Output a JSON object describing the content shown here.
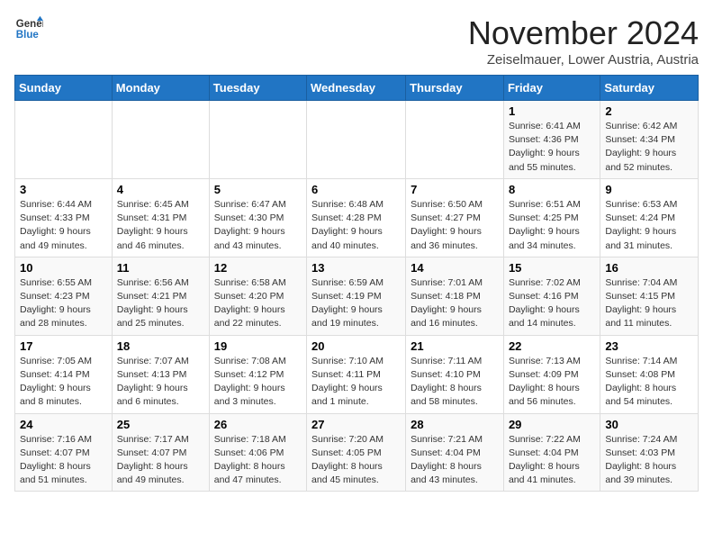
{
  "logo": {
    "line1": "General",
    "line2": "Blue"
  },
  "title": "November 2024",
  "location": "Zeiselmauer, Lower Austria, Austria",
  "days_header": [
    "Sunday",
    "Monday",
    "Tuesday",
    "Wednesday",
    "Thursday",
    "Friday",
    "Saturday"
  ],
  "weeks": [
    [
      {
        "day": "",
        "info": ""
      },
      {
        "day": "",
        "info": ""
      },
      {
        "day": "",
        "info": ""
      },
      {
        "day": "",
        "info": ""
      },
      {
        "day": "",
        "info": ""
      },
      {
        "day": "1",
        "info": "Sunrise: 6:41 AM\nSunset: 4:36 PM\nDaylight: 9 hours\nand 55 minutes."
      },
      {
        "day": "2",
        "info": "Sunrise: 6:42 AM\nSunset: 4:34 PM\nDaylight: 9 hours\nand 52 minutes."
      }
    ],
    [
      {
        "day": "3",
        "info": "Sunrise: 6:44 AM\nSunset: 4:33 PM\nDaylight: 9 hours\nand 49 minutes."
      },
      {
        "day": "4",
        "info": "Sunrise: 6:45 AM\nSunset: 4:31 PM\nDaylight: 9 hours\nand 46 minutes."
      },
      {
        "day": "5",
        "info": "Sunrise: 6:47 AM\nSunset: 4:30 PM\nDaylight: 9 hours\nand 43 minutes."
      },
      {
        "day": "6",
        "info": "Sunrise: 6:48 AM\nSunset: 4:28 PM\nDaylight: 9 hours\nand 40 minutes."
      },
      {
        "day": "7",
        "info": "Sunrise: 6:50 AM\nSunset: 4:27 PM\nDaylight: 9 hours\nand 36 minutes."
      },
      {
        "day": "8",
        "info": "Sunrise: 6:51 AM\nSunset: 4:25 PM\nDaylight: 9 hours\nand 34 minutes."
      },
      {
        "day": "9",
        "info": "Sunrise: 6:53 AM\nSunset: 4:24 PM\nDaylight: 9 hours\nand 31 minutes."
      }
    ],
    [
      {
        "day": "10",
        "info": "Sunrise: 6:55 AM\nSunset: 4:23 PM\nDaylight: 9 hours\nand 28 minutes."
      },
      {
        "day": "11",
        "info": "Sunrise: 6:56 AM\nSunset: 4:21 PM\nDaylight: 9 hours\nand 25 minutes."
      },
      {
        "day": "12",
        "info": "Sunrise: 6:58 AM\nSunset: 4:20 PM\nDaylight: 9 hours\nand 22 minutes."
      },
      {
        "day": "13",
        "info": "Sunrise: 6:59 AM\nSunset: 4:19 PM\nDaylight: 9 hours\nand 19 minutes."
      },
      {
        "day": "14",
        "info": "Sunrise: 7:01 AM\nSunset: 4:18 PM\nDaylight: 9 hours\nand 16 minutes."
      },
      {
        "day": "15",
        "info": "Sunrise: 7:02 AM\nSunset: 4:16 PM\nDaylight: 9 hours\nand 14 minutes."
      },
      {
        "day": "16",
        "info": "Sunrise: 7:04 AM\nSunset: 4:15 PM\nDaylight: 9 hours\nand 11 minutes."
      }
    ],
    [
      {
        "day": "17",
        "info": "Sunrise: 7:05 AM\nSunset: 4:14 PM\nDaylight: 9 hours\nand 8 minutes."
      },
      {
        "day": "18",
        "info": "Sunrise: 7:07 AM\nSunset: 4:13 PM\nDaylight: 9 hours\nand 6 minutes."
      },
      {
        "day": "19",
        "info": "Sunrise: 7:08 AM\nSunset: 4:12 PM\nDaylight: 9 hours\nand 3 minutes."
      },
      {
        "day": "20",
        "info": "Sunrise: 7:10 AM\nSunset: 4:11 PM\nDaylight: 9 hours\nand 1 minute."
      },
      {
        "day": "21",
        "info": "Sunrise: 7:11 AM\nSunset: 4:10 PM\nDaylight: 8 hours\nand 58 minutes."
      },
      {
        "day": "22",
        "info": "Sunrise: 7:13 AM\nSunset: 4:09 PM\nDaylight: 8 hours\nand 56 minutes."
      },
      {
        "day": "23",
        "info": "Sunrise: 7:14 AM\nSunset: 4:08 PM\nDaylight: 8 hours\nand 54 minutes."
      }
    ],
    [
      {
        "day": "24",
        "info": "Sunrise: 7:16 AM\nSunset: 4:07 PM\nDaylight: 8 hours\nand 51 minutes."
      },
      {
        "day": "25",
        "info": "Sunrise: 7:17 AM\nSunset: 4:07 PM\nDaylight: 8 hours\nand 49 minutes."
      },
      {
        "day": "26",
        "info": "Sunrise: 7:18 AM\nSunset: 4:06 PM\nDaylight: 8 hours\nand 47 minutes."
      },
      {
        "day": "27",
        "info": "Sunrise: 7:20 AM\nSunset: 4:05 PM\nDaylight: 8 hours\nand 45 minutes."
      },
      {
        "day": "28",
        "info": "Sunrise: 7:21 AM\nSunset: 4:04 PM\nDaylight: 8 hours\nand 43 minutes."
      },
      {
        "day": "29",
        "info": "Sunrise: 7:22 AM\nSunset: 4:04 PM\nDaylight: 8 hours\nand 41 minutes."
      },
      {
        "day": "30",
        "info": "Sunrise: 7:24 AM\nSunset: 4:03 PM\nDaylight: 8 hours\nand 39 minutes."
      }
    ]
  ]
}
